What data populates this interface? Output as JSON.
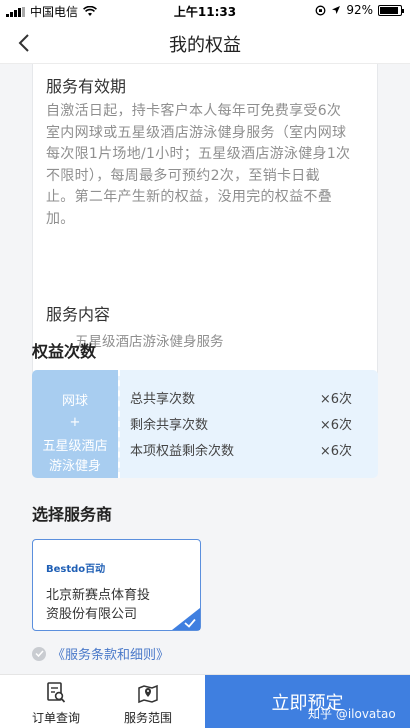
{
  "status_bar": {
    "carrier": "中国电信",
    "time": "上午11:33",
    "battery": "92%"
  },
  "header": {
    "title": "我的权益"
  },
  "validity": {
    "title": "服务有效期",
    "lines": [
      "自激活日起，持卡客户本人每年可免费享受6次",
      "室内网球或五星级酒店游泳健身服务（室内网球",
      "每次限1片场地/1小时；五星级酒店游泳健身1次",
      "不限时），每周最多可预约2次，至销卡日截",
      "止。第二年产生新的权益，没用完的权益不叠",
      "加。"
    ]
  },
  "service_content": {
    "title": "服务内容",
    "item": "五星级酒店游泳健身服务"
  },
  "benefit_count": {
    "title": "权益次数",
    "left": {
      "line1": "网球",
      "plus": "+",
      "line2": "五星级酒店",
      "line3": "游泳健身"
    },
    "rows": [
      {
        "label": "总共享次数",
        "value": "×6次"
      },
      {
        "label": "剩余共享次数",
        "value": "×6次"
      },
      {
        "label": "本项权益剩余次数",
        "value": "×6次"
      }
    ]
  },
  "provider": {
    "title": "选择服务商",
    "logo": "Bestdo百动",
    "name_line1": "北京新赛点体育投",
    "name_line2": "资股份有限公司"
  },
  "terms": {
    "label": "《服务条款和细则》"
  },
  "bottom_bar": {
    "order_query": "订单查询",
    "service_scope": "服务范围",
    "book_now": "立即预定"
  },
  "watermark": "知乎 @ilovatao",
  "colors": {
    "accent": "#3f7fe0",
    "benefit_bg": "#e8f3fd",
    "benefit_left": "#a8cdf0",
    "link": "#4a79c9"
  }
}
